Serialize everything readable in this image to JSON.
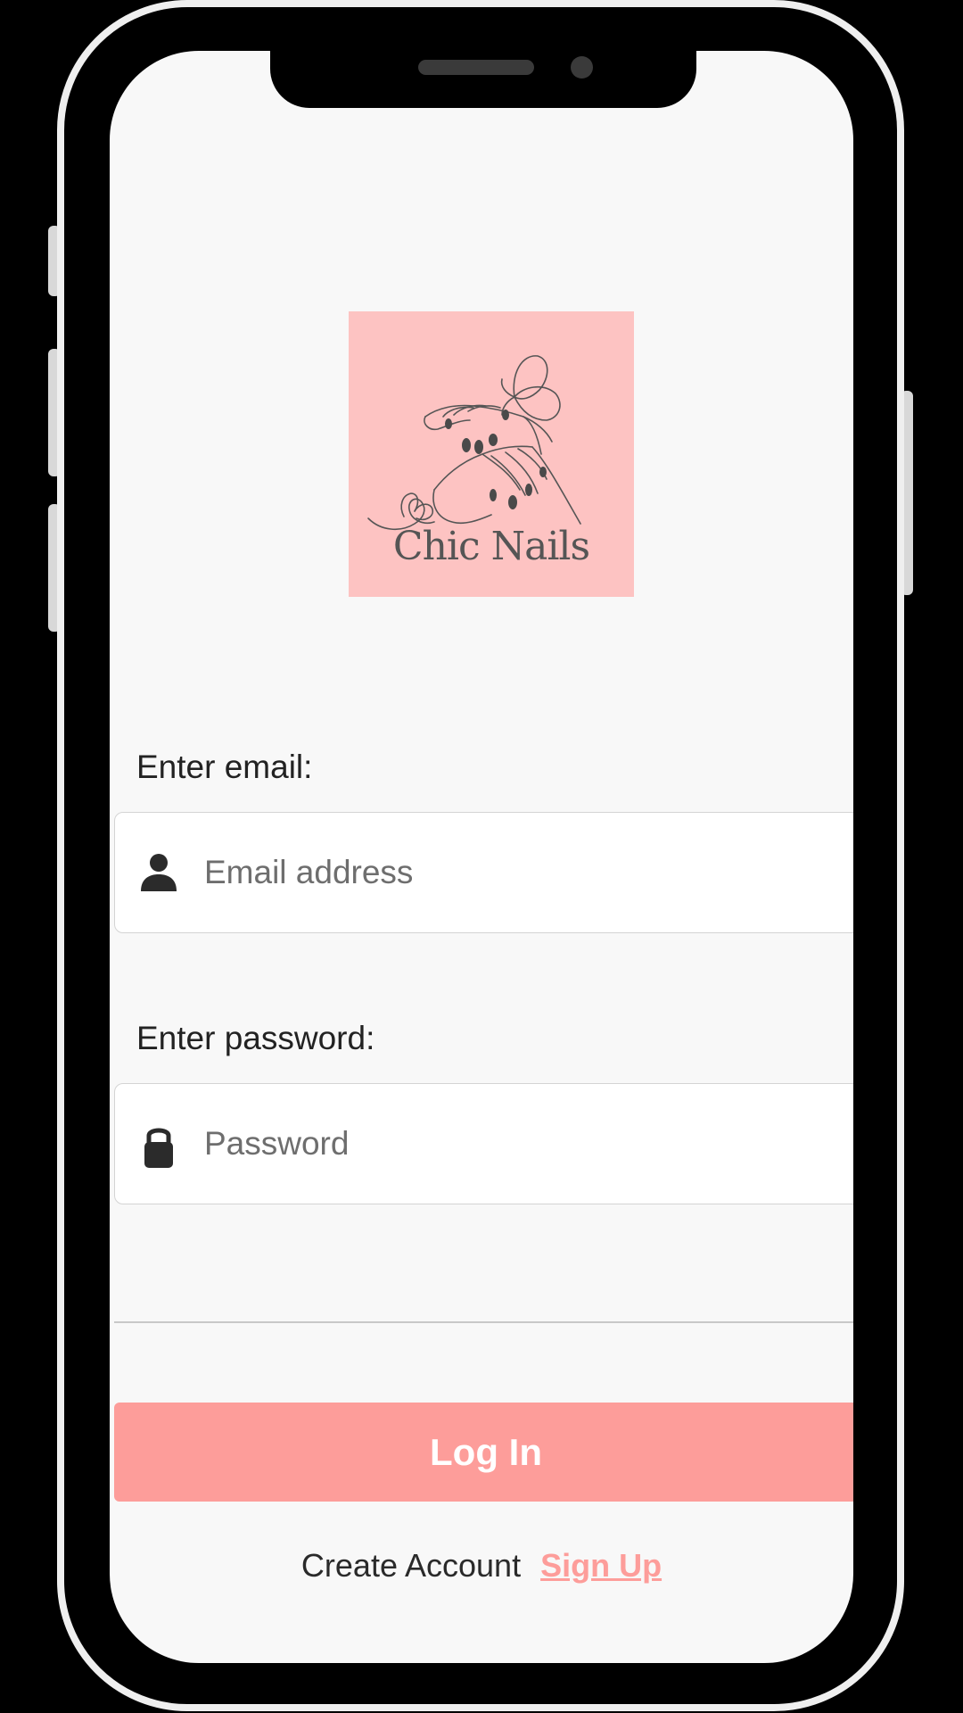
{
  "logo": {
    "text": "Chic Nails",
    "background_color": "#fdc3c2"
  },
  "form": {
    "email_label": "Enter email:",
    "email_placeholder": "Email address",
    "email_icon": "person-icon",
    "password_label": "Enter password:",
    "password_placeholder": "Password",
    "password_icon": "lock-icon"
  },
  "actions": {
    "login_label": "Log In",
    "create_account_text": "Create Account",
    "signup_label": "Sign Up"
  },
  "colors": {
    "accent": "#fd9d9a",
    "screen_background": "#f8f8f8",
    "text": "#222222"
  }
}
